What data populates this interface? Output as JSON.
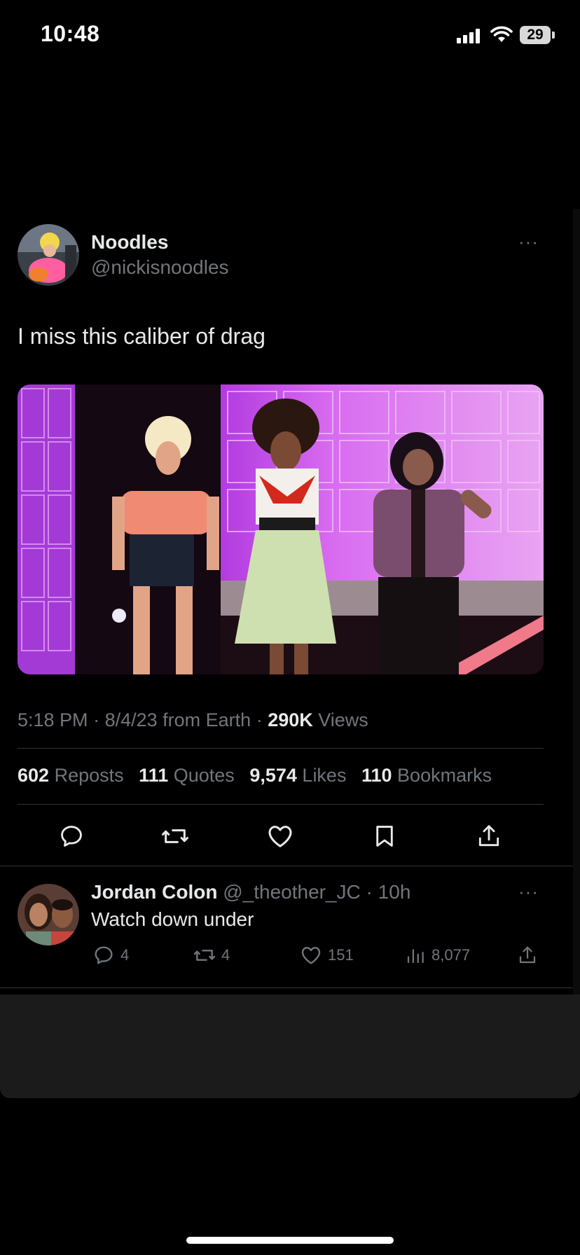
{
  "status_bar": {
    "time": "10:48",
    "battery": "29"
  },
  "tweet": {
    "author": {
      "name": "Noodles",
      "handle": "@nickisnoodles"
    },
    "more": "···",
    "text": "I miss this caliber of drag",
    "meta": {
      "time": "5:18 PM",
      "sep1": " · ",
      "date": "8/4/23",
      "source": " from Earth",
      "sep2": " · ",
      "views_count": "290K",
      "views_label": " Views"
    },
    "stats": {
      "reposts_count": "602",
      "reposts_label": "Reposts",
      "quotes_count": "111",
      "quotes_label": "Quotes",
      "likes_count": "9,574",
      "likes_label": "Likes",
      "bookmarks_count": "110",
      "bookmarks_label": "Bookmarks"
    },
    "actions": [
      "reply-icon",
      "repost-icon",
      "like-icon",
      "bookmark-icon",
      "share-icon"
    ]
  },
  "reply": {
    "author": {
      "name": "Jordan Colon",
      "handle": "@_theother_JC",
      "sep": " · ",
      "age": "10h"
    },
    "more": "···",
    "text": "Watch down under",
    "counts": {
      "replies": "4",
      "reposts": "4",
      "likes": "151",
      "views": "8,077"
    }
  },
  "colors": {
    "background": "#000000",
    "text": "#e7e9ea",
    "muted": "#71767b",
    "divider": "#2f3336"
  }
}
